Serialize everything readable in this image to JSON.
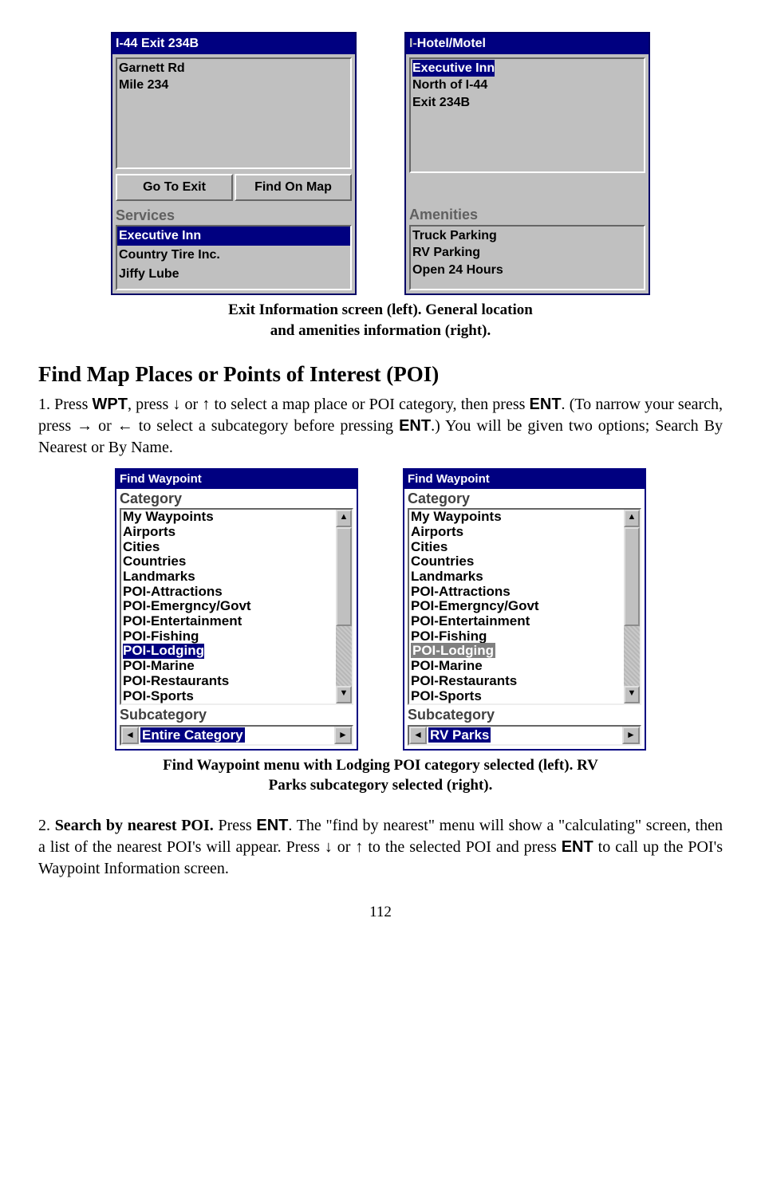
{
  "exit_screen": {
    "title": "I-44 Exit 234B",
    "location_line1": "Garnett Rd",
    "location_line2": "Mile 234",
    "btn_go": "Go To Exit",
    "btn_find": "Find On Map",
    "services_label": "Services",
    "services": [
      "Executive Inn",
      "Country Tire Inc.",
      "Jiffy Lube"
    ]
  },
  "hotel_screen": {
    "title": "Hotel/Motel",
    "loc1": "Executive Inn",
    "loc2": "North of I-44",
    "loc3": "Exit 234B",
    "amen_label": "Amenities",
    "amenities": [
      "Truck Parking",
      "RV Parking",
      "Open 24 Hours"
    ]
  },
  "caption1_line1": "Exit Information screen (left). General location",
  "caption1_line2": "and amenities information (right).",
  "heading": "Find Map Places or Points of Interest (POI)",
  "para1_a": "1. Press ",
  "para1_wpt": "WPT",
  "para1_b": ", press ",
  "para1_c": " or ",
  "para1_d": " to select a map place or POI category, then press ",
  "para1_ent": "ENT",
  "para1_e": ". (To narrow your search, press ",
  "para1_f": " or ",
  "para1_g": " to select a subcategory before pressing ",
  "para1_h": ".) You will be given two options; Search By Nearest or By Name.",
  "findwp": {
    "title": "Find Waypoint",
    "category_label": "Category",
    "items": [
      "My Waypoints",
      "Airports",
      "Cities",
      "Countries",
      "Landmarks",
      "POI-Attractions",
      "POI-Emergncy/Govt",
      "POI-Entertainment",
      "POI-Fishing",
      "POI-Lodging",
      "POI-Marine",
      "POI-Restaurants",
      "POI-Sports"
    ],
    "subcategory_label": "Subcategory",
    "sub_left": "Entire Category",
    "sub_right": "RV Parks"
  },
  "caption2_line1": "Find Waypoint menu with Lodging POI category selected (left). RV",
  "caption2_line2": "Parks subcategory selected (right).",
  "para2_a": "2. ",
  "para2_bold": "Search by nearest POI.",
  "para2_b": " Press ",
  "para2_c": ". The \"find by nearest\" menu will show a \"calculating\" screen, then a list of the nearest POI's will appear. Press ",
  "para2_d": " or ",
  "para2_e": " to the selected POI and press ",
  "para2_f": " to call up the POI's Waypoint Information screen.",
  "page_num": "112"
}
